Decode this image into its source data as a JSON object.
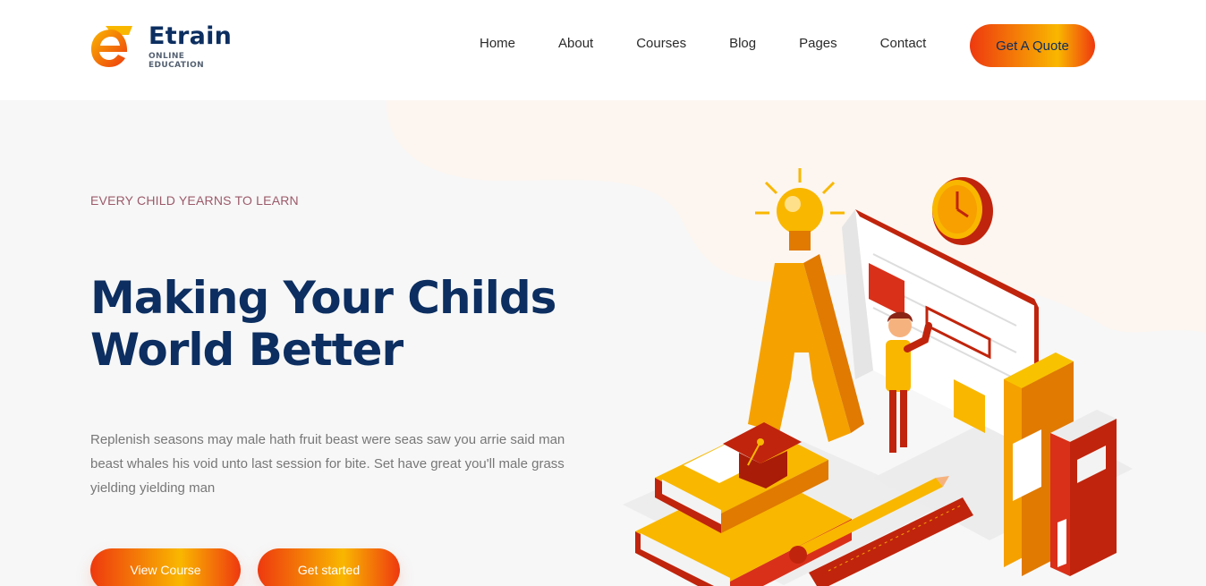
{
  "brand": {
    "name": "Etrain",
    "tagline": "ONLINE EDUCATION",
    "logo_icon": "etrain-e-logo"
  },
  "nav": {
    "items": [
      {
        "label": "Home"
      },
      {
        "label": "About"
      },
      {
        "label": "Courses"
      },
      {
        "label": "Blog"
      },
      {
        "label": "Pages"
      },
      {
        "label": "Contact"
      }
    ],
    "cta_label": "Get A Quote"
  },
  "hero": {
    "kicker": "EVERY CHILD YEARNS TO LEARN",
    "headline": "Making Your Childs World Better",
    "description": "Replenish seasons may male hath fruit beast were seas saw you arrie said man beast whales his void unto last session for bite. Set have great you'll male grass yielding yielding man",
    "primary_button": "View Course",
    "secondary_button": "Get started",
    "illustration": "education-isometric-illustration"
  },
  "colors": {
    "navy": "#0c2e60",
    "orange": "#ee390f",
    "yellow": "#f9b700",
    "hero_bg": "#f7f7f7"
  }
}
